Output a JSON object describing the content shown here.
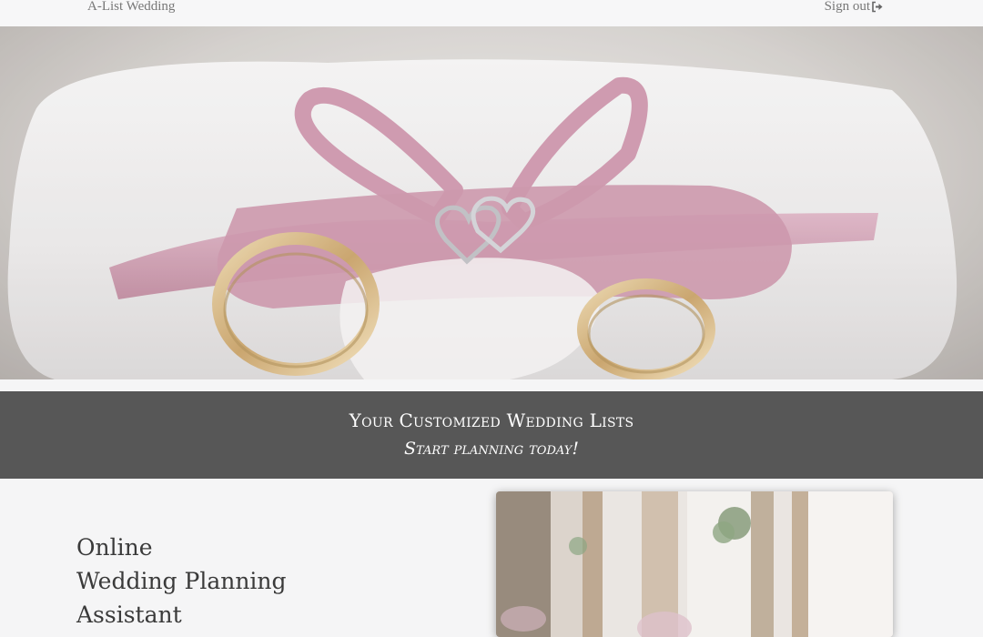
{
  "navbar": {
    "brand": "A-List Wedding",
    "signout_label": "Sign out",
    "signout_icon": "sign-out-icon"
  },
  "hero": {
    "image": "wedding-rings-ribbon-image"
  },
  "banner": {
    "title": "Your Customized Wedding Lists",
    "subtitle": "Start planning today!"
  },
  "intro": {
    "line1": "Online",
    "line2": "Wedding Planning",
    "line3": "Assistant"
  },
  "colors": {
    "banner_bg": "#575757",
    "ribbon": "#c98ea6",
    "gold": "#c8a46a"
  }
}
